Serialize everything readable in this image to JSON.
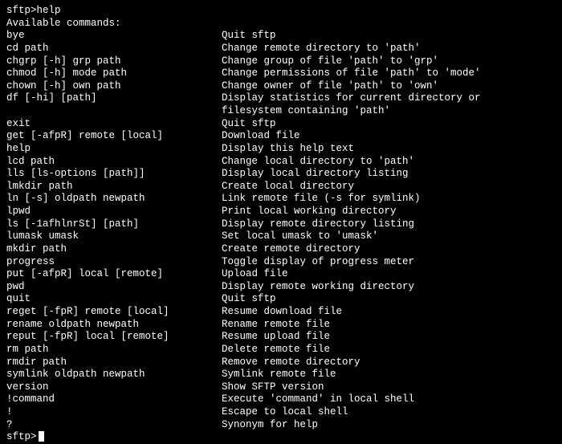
{
  "prompt": "sftp>",
  "typed_command": "help",
  "header": "Available commands:",
  "commands": [
    {
      "cmd": "bye",
      "desc": "Quit sftp"
    },
    {
      "cmd": "cd path",
      "desc": "Change remote directory to 'path'"
    },
    {
      "cmd": "chgrp [-h] grp path",
      "desc": "Change group of file 'path' to 'grp'"
    },
    {
      "cmd": "chmod [-h] mode path",
      "desc": "Change permissions of file 'path' to 'mode'"
    },
    {
      "cmd": "chown [-h] own path",
      "desc": "Change owner of file 'path' to 'own'"
    },
    {
      "cmd": "df [-hi] [path]",
      "desc": "Display statistics for current directory or"
    },
    {
      "cmd": "",
      "desc": "filesystem containing 'path'"
    },
    {
      "cmd": "exit",
      "desc": "Quit sftp"
    },
    {
      "cmd": "get [-afpR] remote [local]",
      "desc": "Download file"
    },
    {
      "cmd": "help",
      "desc": "Display this help text"
    },
    {
      "cmd": "lcd path",
      "desc": "Change local directory to 'path'"
    },
    {
      "cmd": "lls [ls-options [path]]",
      "desc": "Display local directory listing"
    },
    {
      "cmd": "lmkdir path",
      "desc": "Create local directory"
    },
    {
      "cmd": "ln [-s] oldpath newpath",
      "desc": "Link remote file (-s for symlink)"
    },
    {
      "cmd": "lpwd",
      "desc": "Print local working directory"
    },
    {
      "cmd": "ls [-1afhlnrSt] [path]",
      "desc": "Display remote directory listing"
    },
    {
      "cmd": "lumask umask",
      "desc": "Set local umask to 'umask'"
    },
    {
      "cmd": "mkdir path",
      "desc": "Create remote directory"
    },
    {
      "cmd": "progress",
      "desc": "Toggle display of progress meter"
    },
    {
      "cmd": "put [-afpR] local [remote]",
      "desc": "Upload file"
    },
    {
      "cmd": "pwd",
      "desc": "Display remote working directory"
    },
    {
      "cmd": "quit",
      "desc": "Quit sftp"
    },
    {
      "cmd": "reget [-fpR] remote [local]",
      "desc": "Resume download file"
    },
    {
      "cmd": "rename oldpath newpath",
      "desc": "Rename remote file"
    },
    {
      "cmd": "reput [-fpR] local [remote]",
      "desc": "Resume upload file"
    },
    {
      "cmd": "rm path",
      "desc": "Delete remote file"
    },
    {
      "cmd": "rmdir path",
      "desc": "Remove remote directory"
    },
    {
      "cmd": "symlink oldpath newpath",
      "desc": "Symlink remote file"
    },
    {
      "cmd": "version",
      "desc": "Show SFTP version"
    },
    {
      "cmd": "!command",
      "desc": "Execute 'command' in local shell"
    },
    {
      "cmd": "!",
      "desc": "Escape to local shell"
    },
    {
      "cmd": "?",
      "desc": "Synonym for help"
    }
  ],
  "final_prompt": "sftp>"
}
